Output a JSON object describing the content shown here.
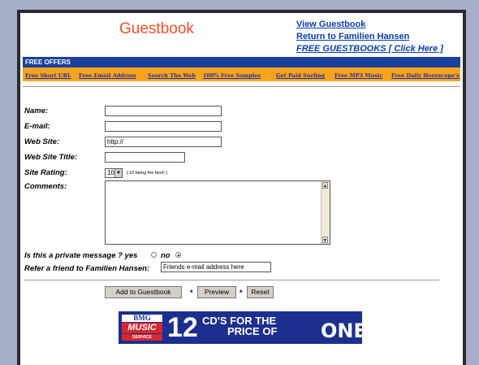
{
  "header": {
    "title": "Guestbook",
    "links": [
      "View Guestbook",
      "Return to Familien Hansen",
      "FREE GUESTBOOKS [ Click Here ]"
    ]
  },
  "offers": {
    "title": "FREE OFFERS",
    "items": [
      "Free Short URL",
      "Free Email Address",
      "Search The Web",
      "100% Free Samples",
      "Get Paid Surfing",
      "Free MP3 Music",
      "Free Daily Horoscope's"
    ]
  },
  "form": {
    "name_label": "Name:",
    "email_label": "E-mail:",
    "website_label": "Web Site:",
    "website_value": "http://",
    "website_title_label": "Web Site Title:",
    "rating_label": "Site Rating:",
    "rating_value": "10",
    "rating_note": "[ 10 being the best! ]",
    "comments_label": "Comments:",
    "private_label": "Is this a private message ? yes",
    "private_no": "no",
    "private_selected": "no",
    "refer_label": "Refer a friend to Familien Hansen:",
    "refer_value": "Friends e-mail address here"
  },
  "buttons": {
    "add": "Add to Guestbook",
    "preview": "Preview",
    "reset": "Reset",
    "separator": "*"
  },
  "banner": {
    "logo_top": "BMG",
    "logo_middle": "MUSIC",
    "logo_bottom": "SERVICE",
    "big_number": "12",
    "line1": "CD'S FOR THE",
    "line2": "PRICE OF",
    "one": "ONE"
  },
  "colors": {
    "title": "#f2502a",
    "link": "#0b3ea8",
    "offers_bar": "#f6a41c",
    "offers_title_bg": "#1b3f9c",
    "banner_bg": "#1c2f8e"
  }
}
